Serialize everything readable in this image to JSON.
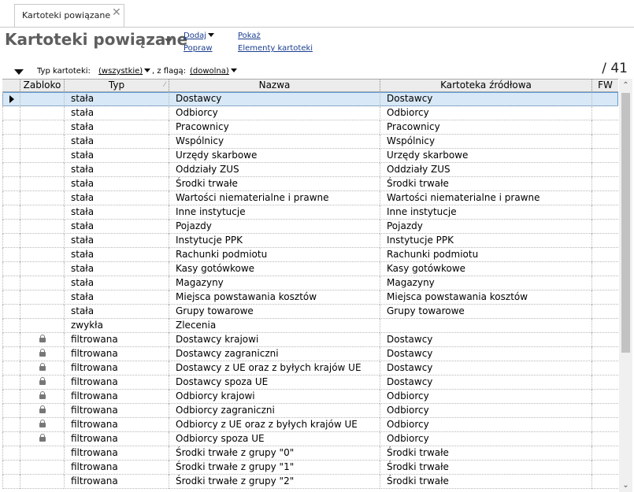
{
  "tab": {
    "label": "Kartoteki powiązane",
    "close": "✕"
  },
  "header": {
    "title": "Kartoteki powiązane",
    "menu": {
      "dodaj": "Dodaj",
      "popraw": "Popraw",
      "pokaz": "Pokaż",
      "elementy": "Elementy kartoteki"
    }
  },
  "filter": {
    "typ_label": "Typ kartoteki:",
    "typ_value": "(wszystkie)",
    "flaga_label": ", z flagą:",
    "flaga_value": "(dowolna)"
  },
  "count": "/ 41",
  "table": {
    "columns": [
      "Zabloko",
      "Typ",
      "Nazwa",
      "Kartoteka źródłowa",
      "FW"
    ],
    "rows": [
      {
        "locked": false,
        "typ": "stała",
        "nazwa": "Dostawcy",
        "zrodlo": "Dostawcy"
      },
      {
        "locked": false,
        "typ": "stała",
        "nazwa": "Odbiorcy",
        "zrodlo": "Odbiorcy"
      },
      {
        "locked": false,
        "typ": "stała",
        "nazwa": "Pracownicy",
        "zrodlo": "Pracownicy"
      },
      {
        "locked": false,
        "typ": "stała",
        "nazwa": "Wspólnicy",
        "zrodlo": "Wspólnicy"
      },
      {
        "locked": false,
        "typ": "stała",
        "nazwa": "Urzędy skarbowe",
        "zrodlo": "Urzędy skarbowe"
      },
      {
        "locked": false,
        "typ": "stała",
        "nazwa": "Oddziały ZUS",
        "zrodlo": "Oddziały ZUS"
      },
      {
        "locked": false,
        "typ": "stała",
        "nazwa": "Środki trwałe",
        "zrodlo": "Środki trwałe"
      },
      {
        "locked": false,
        "typ": "stała",
        "nazwa": "Wartości niematerialne i prawne",
        "zrodlo": "Wartości niematerialne i prawne"
      },
      {
        "locked": false,
        "typ": "stała",
        "nazwa": "Inne instytucje",
        "zrodlo": "Inne instytucje"
      },
      {
        "locked": false,
        "typ": "stała",
        "nazwa": "Pojazdy",
        "zrodlo": "Pojazdy"
      },
      {
        "locked": false,
        "typ": "stała",
        "nazwa": "Instytucje PPK",
        "zrodlo": "Instytucje PPK"
      },
      {
        "locked": false,
        "typ": "stała",
        "nazwa": "Rachunki podmiotu",
        "zrodlo": "Rachunki podmiotu"
      },
      {
        "locked": false,
        "typ": "stała",
        "nazwa": "Kasy gotówkowe",
        "zrodlo": "Kasy gotówkowe"
      },
      {
        "locked": false,
        "typ": "stała",
        "nazwa": "Magazyny",
        "zrodlo": "Magazyny"
      },
      {
        "locked": false,
        "typ": "stała",
        "nazwa": "Miejsca powstawania kosztów",
        "zrodlo": "Miejsca powstawania kosztów"
      },
      {
        "locked": false,
        "typ": "stała",
        "nazwa": "Grupy towarowe",
        "zrodlo": "Grupy towarowe"
      },
      {
        "locked": false,
        "typ": "zwykła",
        "nazwa": "Zlecenia",
        "zrodlo": ""
      },
      {
        "locked": true,
        "typ": "filtrowana",
        "nazwa": "Dostawcy krajowi",
        "zrodlo": "Dostawcy"
      },
      {
        "locked": true,
        "typ": "filtrowana",
        "nazwa": "Dostawcy zagraniczni",
        "zrodlo": "Dostawcy"
      },
      {
        "locked": true,
        "typ": "filtrowana",
        "nazwa": "Dostawcy z UE oraz z byłych krajów UE",
        "zrodlo": "Dostawcy"
      },
      {
        "locked": true,
        "typ": "filtrowana",
        "nazwa": "Dostawcy spoza UE",
        "zrodlo": "Dostawcy"
      },
      {
        "locked": true,
        "typ": "filtrowana",
        "nazwa": "Odbiorcy krajowi",
        "zrodlo": "Odbiorcy"
      },
      {
        "locked": true,
        "typ": "filtrowana",
        "nazwa": "Odbiorcy zagraniczni",
        "zrodlo": "Odbiorcy"
      },
      {
        "locked": true,
        "typ": "filtrowana",
        "nazwa": "Odbiorcy z UE oraz z byłych krajów UE",
        "zrodlo": "Odbiorcy"
      },
      {
        "locked": true,
        "typ": "filtrowana",
        "nazwa": "Odbiorcy spoza UE",
        "zrodlo": "Odbiorcy"
      },
      {
        "locked": false,
        "typ": "filtrowana",
        "nazwa": "Środki trwałe z grupy \"0\"",
        "zrodlo": "Środki trwałe"
      },
      {
        "locked": false,
        "typ": "filtrowana",
        "nazwa": "Środki trwałe z grupy \"1\"",
        "zrodlo": "Środki trwałe"
      },
      {
        "locked": false,
        "typ": "filtrowana",
        "nazwa": "Środki trwałe z grupy \"2\"",
        "zrodlo": "Środki trwałe"
      }
    ],
    "selected_row": 0
  },
  "scrollbar": {
    "up": "⌃",
    "down": "⌄"
  }
}
